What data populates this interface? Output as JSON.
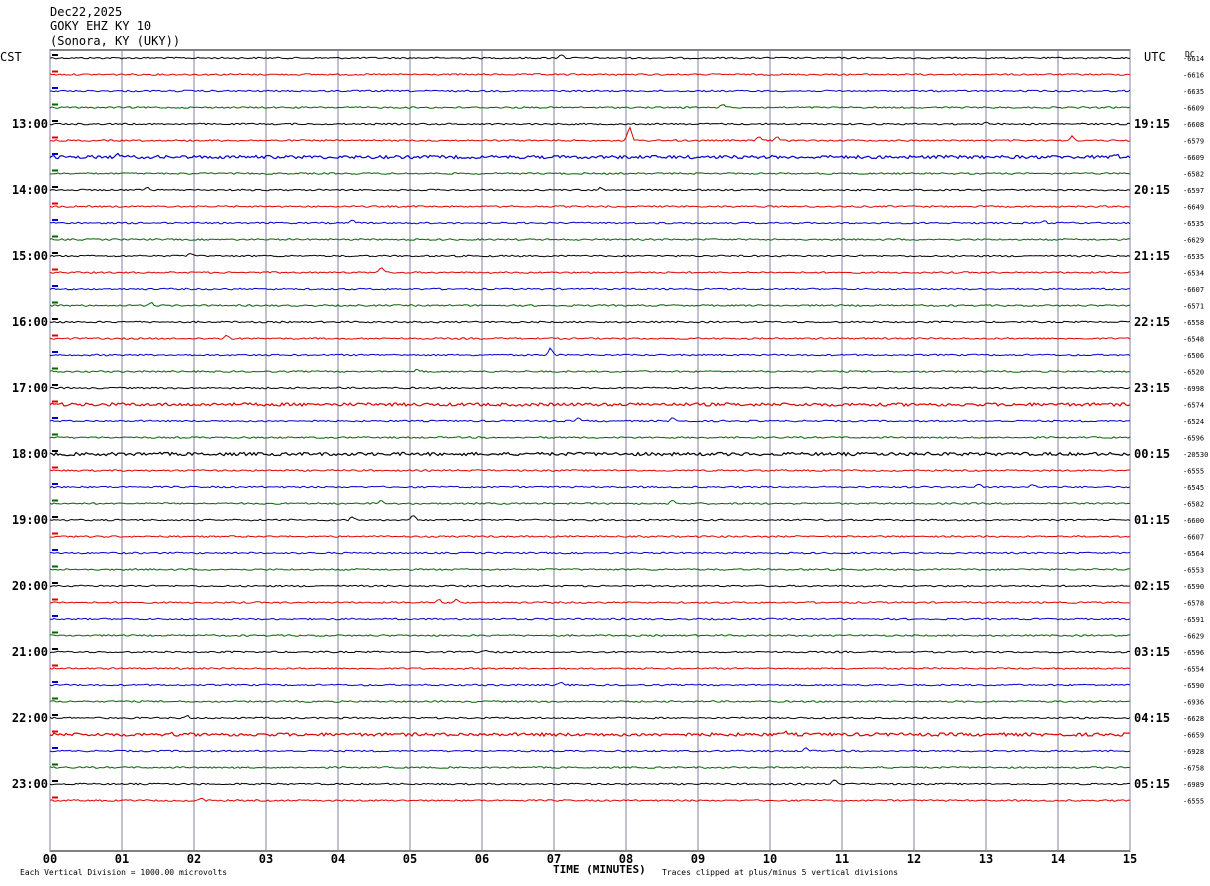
{
  "header": {
    "date": "Dec22,2025",
    "station": "GOKY EHZ KY 10",
    "location": "(Sonora, KY (UKY))",
    "left_tz": "CST",
    "right_tz": "UTC",
    "dc_label": "DC"
  },
  "footer": {
    "scale_note": "Each Vertical Division = 1000.00 microvolts",
    "xlabel": "TIME (MINUTES)",
    "clip_note": "Traces clipped at plus/minus 5 vertical divisions"
  },
  "chart_data": {
    "type": "line",
    "subtype": "helicorder",
    "x_unit": "minutes",
    "xlim": [
      0,
      15
    ],
    "x_ticks": [
      "00",
      "01",
      "02",
      "03",
      "04",
      "05",
      "06",
      "07",
      "08",
      "09",
      "10",
      "11",
      "12",
      "13",
      "14",
      "15"
    ],
    "trace_colors": [
      "#000000",
      "#dd0000",
      "#0000cc",
      "#006600"
    ],
    "hour_labels_left": [
      "13:00",
      "14:00",
      "15:00",
      "16:00",
      "17:00",
      "18:00",
      "19:00",
      "20:00",
      "21:00",
      "22:00",
      "23:00"
    ],
    "hour_labels_right": [
      "19:15",
      "20:15",
      "21:15",
      "22:15",
      "23:15",
      "00:15",
      "01:15",
      "02:15",
      "03:15",
      "04:15",
      "05:15"
    ],
    "dc_offsets": [
      "-6614",
      "-6616",
      "-6635",
      "-6609",
      "-6608",
      "-6579",
      "-6609",
      "-6582",
      "-6597",
      "-6649",
      "-6535",
      "-6629",
      "-6535",
      "-6534",
      "-6607",
      "-6571",
      "-6558",
      "-6548",
      "-6506",
      "-6520",
      "-6998",
      "-6574",
      "-6524",
      "-6596",
      "-20530",
      "-6555",
      "-6545",
      "-6582",
      "-6600",
      "-6607",
      "-6564",
      "-6553",
      "-6590",
      "-6578",
      "-6591",
      "-6629",
      "-6596",
      "-6554",
      "-6590",
      "-6936",
      "-6628",
      "-6659",
      "-6928",
      "-6758",
      "-6989",
      "-6555"
    ],
    "events": [
      {
        "trace": 0,
        "minute": 7.1,
        "amp": 0.25
      },
      {
        "trace": 3,
        "minute": 9.35,
        "amp": 0.25
      },
      {
        "trace": 4,
        "minute": 13.0,
        "amp": 0.15
      },
      {
        "trace": 5,
        "minute": 8.05,
        "amp": 0.85
      },
      {
        "trace": 5,
        "minute": 9.85,
        "amp": 0.25
      },
      {
        "trace": 5,
        "minute": 10.1,
        "amp": 0.2
      },
      {
        "trace": 5,
        "minute": 14.2,
        "amp": 0.3
      },
      {
        "trace": 6,
        "minute": 0.95,
        "amp": 0.2
      },
      {
        "trace": 6,
        "minute": 14.8,
        "amp": 0.15
      },
      {
        "trace": 8,
        "minute": 1.35,
        "amp": 0.15
      },
      {
        "trace": 8,
        "minute": 7.65,
        "amp": 0.15
      },
      {
        "trace": 10,
        "minute": 4.2,
        "amp": 0.15
      },
      {
        "trace": 10,
        "minute": 13.8,
        "amp": 0.15
      },
      {
        "trace": 12,
        "minute": 1.95,
        "amp": 0.15
      },
      {
        "trace": 13,
        "minute": 4.6,
        "amp": 0.3
      },
      {
        "trace": 15,
        "minute": 1.4,
        "amp": 0.2
      },
      {
        "trace": 17,
        "minute": 2.45,
        "amp": 0.2
      },
      {
        "trace": 18,
        "minute": 6.95,
        "amp": 0.4
      },
      {
        "trace": 19,
        "minute": 5.1,
        "amp": 0.15
      },
      {
        "trace": 22,
        "minute": 7.35,
        "amp": 0.2
      },
      {
        "trace": 22,
        "minute": 8.65,
        "amp": 0.2
      },
      {
        "trace": 24,
        "minute": 12.2,
        "amp": 0.15
      },
      {
        "trace": 26,
        "minute": 12.9,
        "amp": 0.15
      },
      {
        "trace": 26,
        "minute": 13.65,
        "amp": 0.15
      },
      {
        "trace": 27,
        "minute": 4.6,
        "amp": 0.25
      },
      {
        "trace": 27,
        "minute": 8.65,
        "amp": 0.2
      },
      {
        "trace": 28,
        "minute": 4.2,
        "amp": 0.2
      },
      {
        "trace": 28,
        "minute": 5.05,
        "amp": 0.3
      },
      {
        "trace": 33,
        "minute": 5.4,
        "amp": 0.2
      },
      {
        "trace": 33,
        "minute": 5.65,
        "amp": 0.2
      },
      {
        "trace": 36,
        "minute": 6.05,
        "amp": 0.15
      },
      {
        "trace": 38,
        "minute": 7.1,
        "amp": 0.2
      },
      {
        "trace": 40,
        "minute": 1.9,
        "amp": 0.15
      },
      {
        "trace": 41,
        "minute": 1.65,
        "amp": 0.15
      },
      {
        "trace": 41,
        "minute": 10.2,
        "amp": 0.2
      },
      {
        "trace": 42,
        "minute": 10.5,
        "amp": 0.2
      },
      {
        "trace": 44,
        "minute": 10.9,
        "amp": 0.3
      },
      {
        "trace": 45,
        "minute": 2.1,
        "amp": 0.15
      },
      {
        "trace": 46,
        "minute": 7.0,
        "amp": 0.15
      }
    ],
    "noisy_traces": [
      24,
      41,
      6,
      21
    ]
  }
}
